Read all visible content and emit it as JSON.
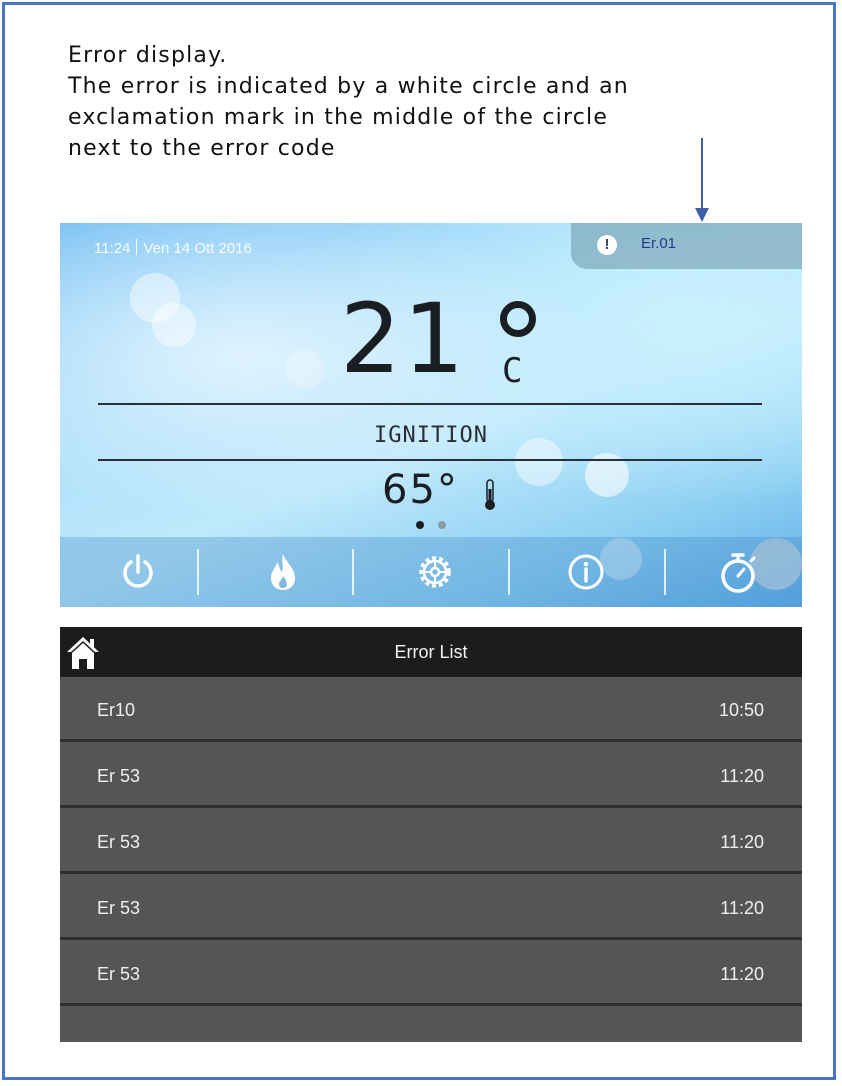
{
  "caption": {
    "lines": [
      "Error display.",
      "The error is indicated by a white circle and an",
      "exclamation mark in the middle of the circle",
      "next to the error code"
    ]
  },
  "device": {
    "time": "11:24",
    "date": "Ven 14 Ott 2016",
    "error_badge": {
      "icon": "!",
      "code": "Er.01"
    },
    "room_temp": "21",
    "room_unit": "C",
    "mode": "IGNITION",
    "water_temp": "65°",
    "page_dots": {
      "active": 1,
      "count": 2
    },
    "nav": [
      {
        "icon": "power-icon"
      },
      {
        "icon": "flame-icon"
      },
      {
        "icon": "gear-icon"
      },
      {
        "icon": "info-icon"
      },
      {
        "icon": "stopwatch-icon"
      }
    ]
  },
  "error_list": {
    "title": "Error List",
    "home_icon": "home-icon",
    "rows": [
      {
        "code": "Er10",
        "time": "10:50"
      },
      {
        "code": "Er 53",
        "time": "11:20"
      },
      {
        "code": "Er 53",
        "time": "11:20"
      },
      {
        "code": "Er 53",
        "time": "11:20"
      },
      {
        "code": "Er 53",
        "time": "11:20"
      }
    ]
  },
  "colors": {
    "frame_border": "#4a74c9",
    "arrow": "#3f5fa8",
    "list_row": "#555555",
    "list_header": "#1c1c1c"
  }
}
